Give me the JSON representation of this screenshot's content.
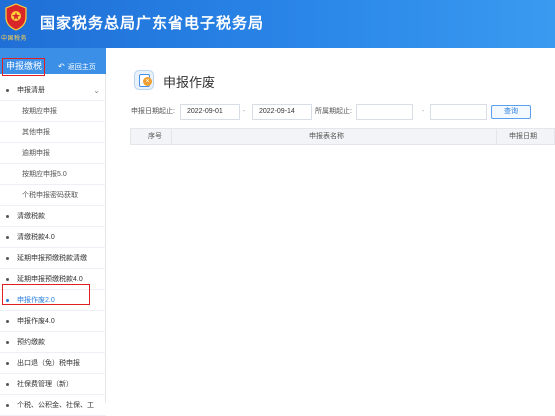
{
  "header": {
    "title": "国家税务总局广东省电子税务局",
    "emblem_caption": "中国税务"
  },
  "sidebar": {
    "section_title": "申报缴税",
    "back_label": "返回主页",
    "items": [
      {
        "label": "申报清册",
        "level": 1,
        "expanded": true
      },
      {
        "label": "按期应申报",
        "level": 2
      },
      {
        "label": "其他申报",
        "level": 2
      },
      {
        "label": "逾期申报",
        "level": 2
      },
      {
        "label": "按期应申报5.0",
        "level": 2
      },
      {
        "label": "个税申报密码获取",
        "level": 2
      },
      {
        "label": "清缴税款",
        "level": 1
      },
      {
        "label": "清缴税款4.0",
        "level": 1
      },
      {
        "label": "延期申报预缴税款清缴",
        "level": 1
      },
      {
        "label": "延期申报预缴税款4.0",
        "level": 1
      },
      {
        "label": "申报作废2.0",
        "level": 1,
        "active": true
      },
      {
        "label": "申报作废4.0",
        "level": 1
      },
      {
        "label": "预约缴款",
        "level": 1
      },
      {
        "label": "出口退（免）税申报",
        "level": 1
      },
      {
        "label": "社保费管理（新）",
        "level": 1
      },
      {
        "label": "个税、公积金、社保、工",
        "level": 1
      }
    ]
  },
  "main": {
    "title": "申报作废",
    "filters": {
      "date_label": "申报日期起止:",
      "date_from": "2022-09-01",
      "date_sep": "-",
      "date_to": "2022-09-14",
      "period_label": "所属期起止:",
      "period_from": "",
      "period_sep": "-",
      "period_to": "",
      "query_label": "查询"
    },
    "table": {
      "columns": [
        "序号",
        "申报表名称",
        "申报日期"
      ],
      "rows": []
    }
  },
  "colors": {
    "header_blue": "#2a86e8",
    "sidebar_head": "#3c8fe6",
    "highlight_red": "#e02020",
    "active_link": "#2a7fe0"
  }
}
